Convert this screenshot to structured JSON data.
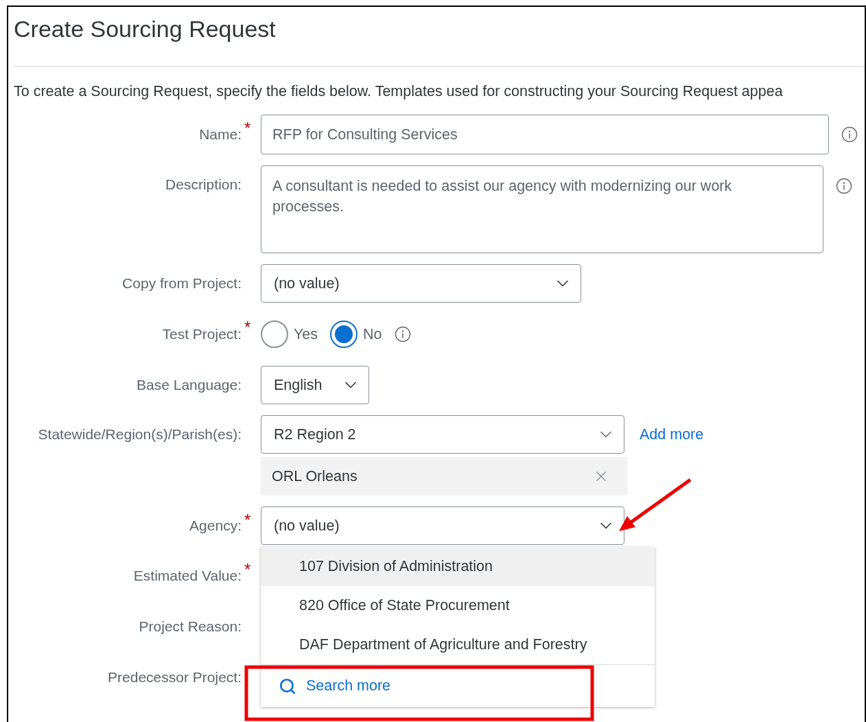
{
  "title": "Create Sourcing Request",
  "required_mark": "*",
  "intro": "To create a Sourcing Request, specify the fields below. Templates used for constructing your Sourcing Request appea",
  "fields": [
    {
      "kind": "text",
      "label": "Name:",
      "required": true,
      "info": true,
      "value": "RFP for Consulting Services"
    },
    {
      "kind": "textarea",
      "label": "Description:",
      "required": false,
      "info": true,
      "value": "A consultant is needed to assist our agency with modernizing our work processes."
    },
    {
      "kind": "select",
      "label": "Copy from Project:",
      "required": false,
      "info": false,
      "value": "(no value)"
    },
    {
      "kind": "radio",
      "label": "Test Project:",
      "required": true,
      "info": true,
      "options": [
        {
          "label": "Yes",
          "selected": false
        },
        {
          "label": "No",
          "selected": true
        }
      ]
    },
    {
      "kind": "select",
      "label": "Base Language:",
      "required": false,
      "info": false,
      "value": "English"
    },
    {
      "kind": "multiselect",
      "label": "Statewide/Region(s)/Parish(es):",
      "required": false,
      "info": false,
      "value": "R2 Region 2",
      "link": "Add more",
      "tokens": [
        "ORL Orleans"
      ]
    },
    {
      "kind": "select",
      "label": "Agency:",
      "required": true,
      "info": false,
      "value": "(no value)",
      "expanded": true
    },
    {
      "kind": "label",
      "label": "Estimated Value:",
      "required": true,
      "info": false
    },
    {
      "kind": "label",
      "label": "Project Reason:",
      "required": false,
      "info": false
    },
    {
      "kind": "label",
      "label": "Predecessor Project:",
      "required": false,
      "info": false
    }
  ],
  "dropdown": {
    "options": [
      {
        "label": "107 Division of Administration",
        "highlighted": true
      },
      {
        "label": "820 Office of State Procurement",
        "highlighted": false
      },
      {
        "label": "DAF Department of Agriculture and Forestry",
        "highlighted": false
      }
    ],
    "search": "Search more"
  }
}
